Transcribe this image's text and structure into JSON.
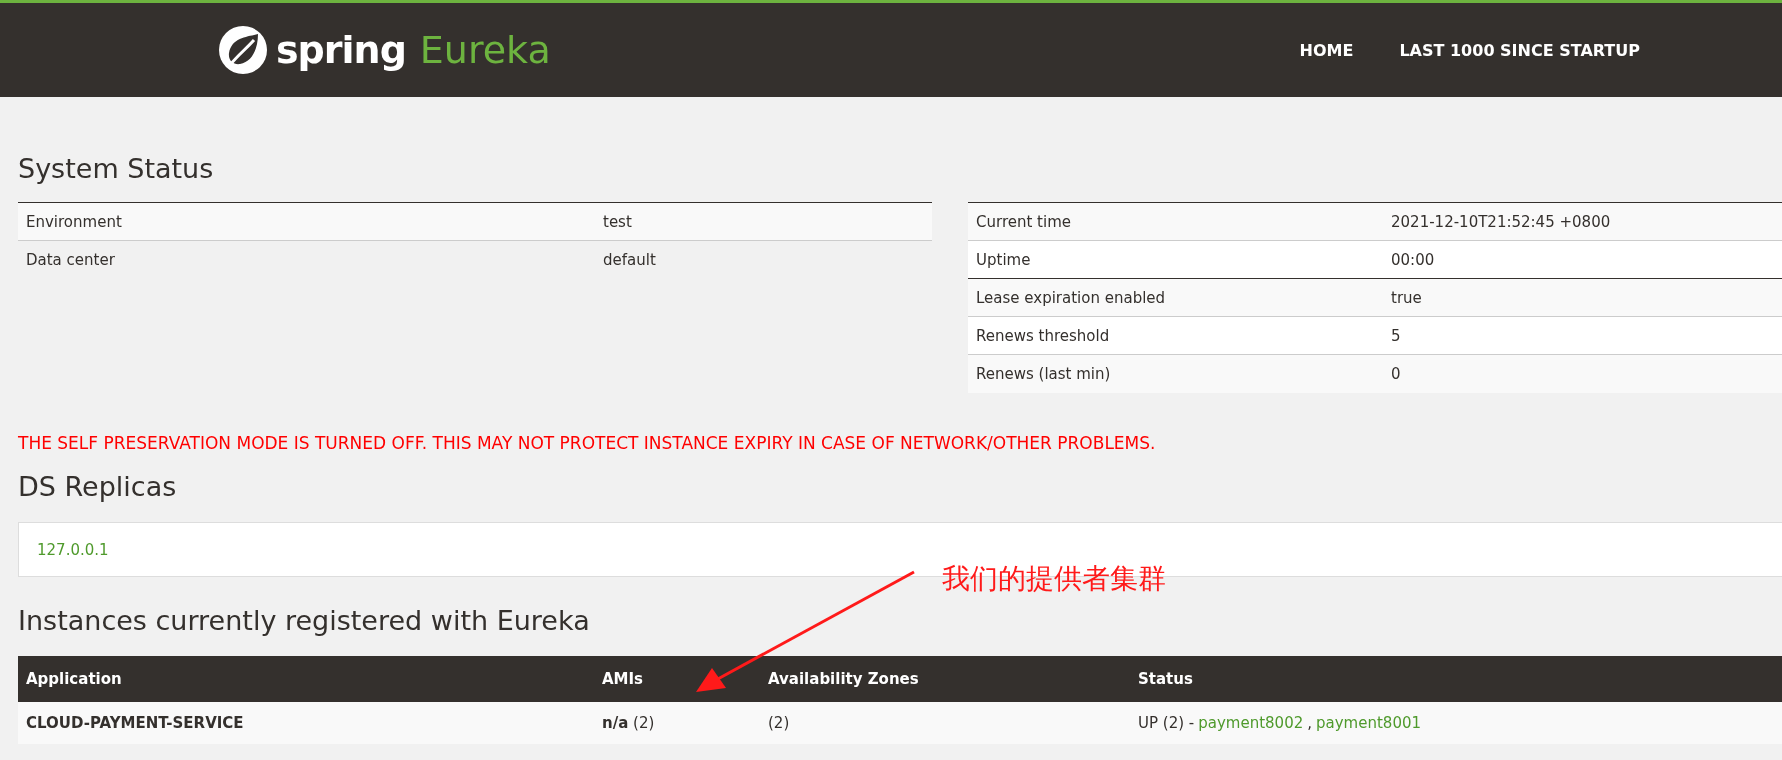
{
  "navbar": {
    "brand": {
      "word_1": "spring",
      "word_2": "Eureka"
    },
    "links": [
      "HOME",
      "LAST 1000 SINCE STARTUP"
    ]
  },
  "system_status": {
    "title": "System Status",
    "left_table": [
      {
        "name": "Environment",
        "value": "test"
      },
      {
        "name": "Data center",
        "value": "default"
      }
    ],
    "right_table": [
      {
        "name": "Current time",
        "value": "2021-12-10T21:52:45 +0800"
      },
      {
        "name": "Uptime",
        "value": "00:00"
      },
      {
        "name": "Lease expiration enabled",
        "value": "true"
      },
      {
        "name": "Renews threshold",
        "value": "5"
      },
      {
        "name": "Renews (last min)",
        "value": "0"
      }
    ]
  },
  "warning": "THE SELF PRESERVATION MODE IS TURNED OFF. THIS MAY NOT PROTECT INSTANCE EXPIRY IN CASE OF NETWORK/OTHER PROBLEMS.",
  "ds_replicas": {
    "title": "DS Replicas",
    "items": [
      "127.0.0.1"
    ]
  },
  "instances": {
    "title": "Instances currently registered with Eureka",
    "columns": [
      "Application",
      "AMIs",
      "Availability Zones",
      "Status"
    ],
    "rows": [
      {
        "application": "CLOUD-PAYMENT-SERVICE",
        "amis": "**n/a** (2)",
        "zones": "(2)",
        "status": "UP (2) -",
        "links": [
          "payment8002",
          "payment8001"
        ],
        "separator": ","
      }
    ]
  },
  "annotation": {
    "text": "我们的提供者集群"
  }
}
